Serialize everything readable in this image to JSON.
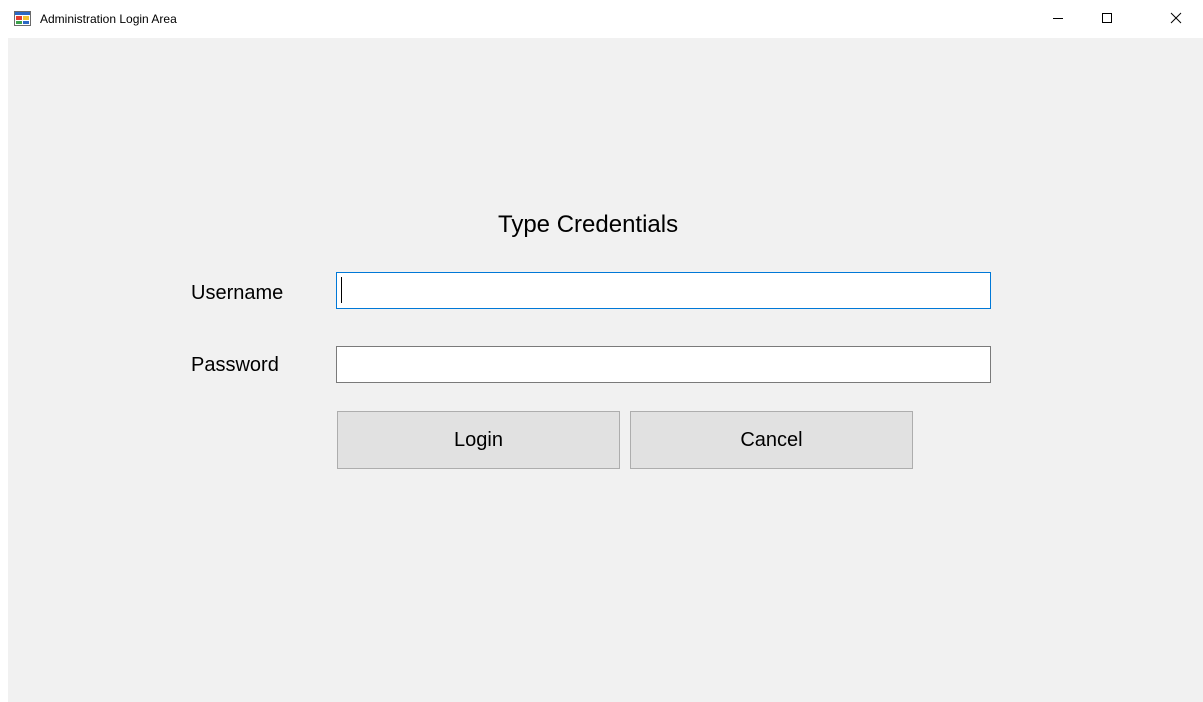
{
  "window": {
    "title": "Administration Login Area",
    "icon": "app-window-icon",
    "controls": {
      "minimize_icon": "minimize-icon",
      "maximize_icon": "maximize-icon",
      "close_icon": "close-icon"
    }
  },
  "form": {
    "heading": "Type Credentials",
    "username": {
      "label": "Username",
      "value": ""
    },
    "password": {
      "label": "Password",
      "value": ""
    },
    "buttons": {
      "login_label": "Login",
      "cancel_label": "Cancel"
    }
  },
  "colors": {
    "client_background": "#f1f1f1",
    "focus_border": "#0078d7",
    "button_face": "#e1e1e1"
  }
}
